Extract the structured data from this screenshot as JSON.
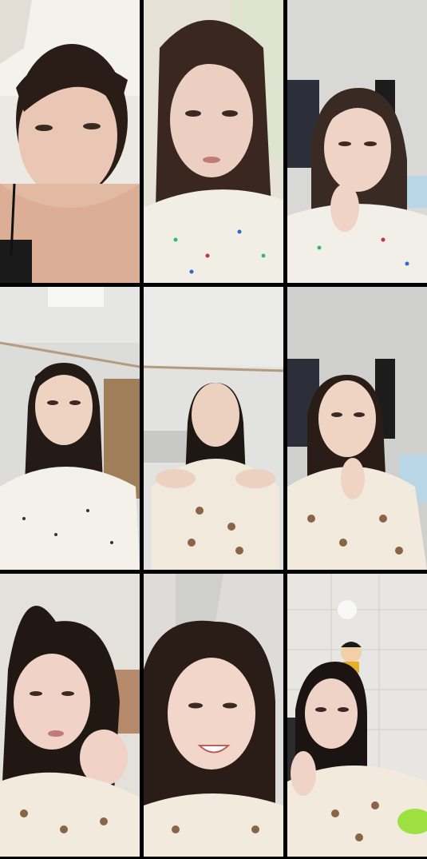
{
  "grid": {
    "rows": 3,
    "columns": 3,
    "tiles": [
      {
        "id": 1,
        "background": "#ece9e2",
        "skin": "#e9c7b4",
        "hair": "#2a1c16",
        "top": "#1a1a1a",
        "pattern": "none"
      },
      {
        "id": 2,
        "background": "#e6e2d6",
        "skin": "#eccfc0",
        "hair": "#3a2820",
        "top": "#f1eee6",
        "pattern": "dots"
      },
      {
        "id": 3,
        "background": "#d8d8d6",
        "skin": "#efd3c4",
        "hair": "#3a2a24",
        "top": "#f1efe8",
        "pattern": "dots"
      },
      {
        "id": 4,
        "background": "#dcdcda",
        "skin": "#eed2c2",
        "hair": "#241a16",
        "top": "#f3f1ea",
        "pattern": "dots"
      },
      {
        "id": 5,
        "background": "#e2e2e0",
        "skin": "#ecd0c0",
        "hair": "#1f1714",
        "top": "#f0e9dc",
        "pattern": "bears"
      },
      {
        "id": 6,
        "background": "#cfcfcd",
        "skin": "#efd4c4",
        "hair": "#2a1d18",
        "top": "#f1eadd",
        "pattern": "bears"
      },
      {
        "id": 7,
        "background": "#e4e1da",
        "skin": "#f0d2c6",
        "hair": "#221813",
        "top": "#f1eadd",
        "pattern": "bears"
      },
      {
        "id": 8,
        "background": "#dedcd8",
        "skin": "#f2d6ca",
        "hair": "#2a1c16",
        "top": "#f1eadd",
        "pattern": "bears"
      },
      {
        "id": 9,
        "background": "#e8e6e2",
        "skin": "#efd3c6",
        "hair": "#1c1412",
        "top": "#f1eadd",
        "pattern": "bears"
      }
    ]
  }
}
